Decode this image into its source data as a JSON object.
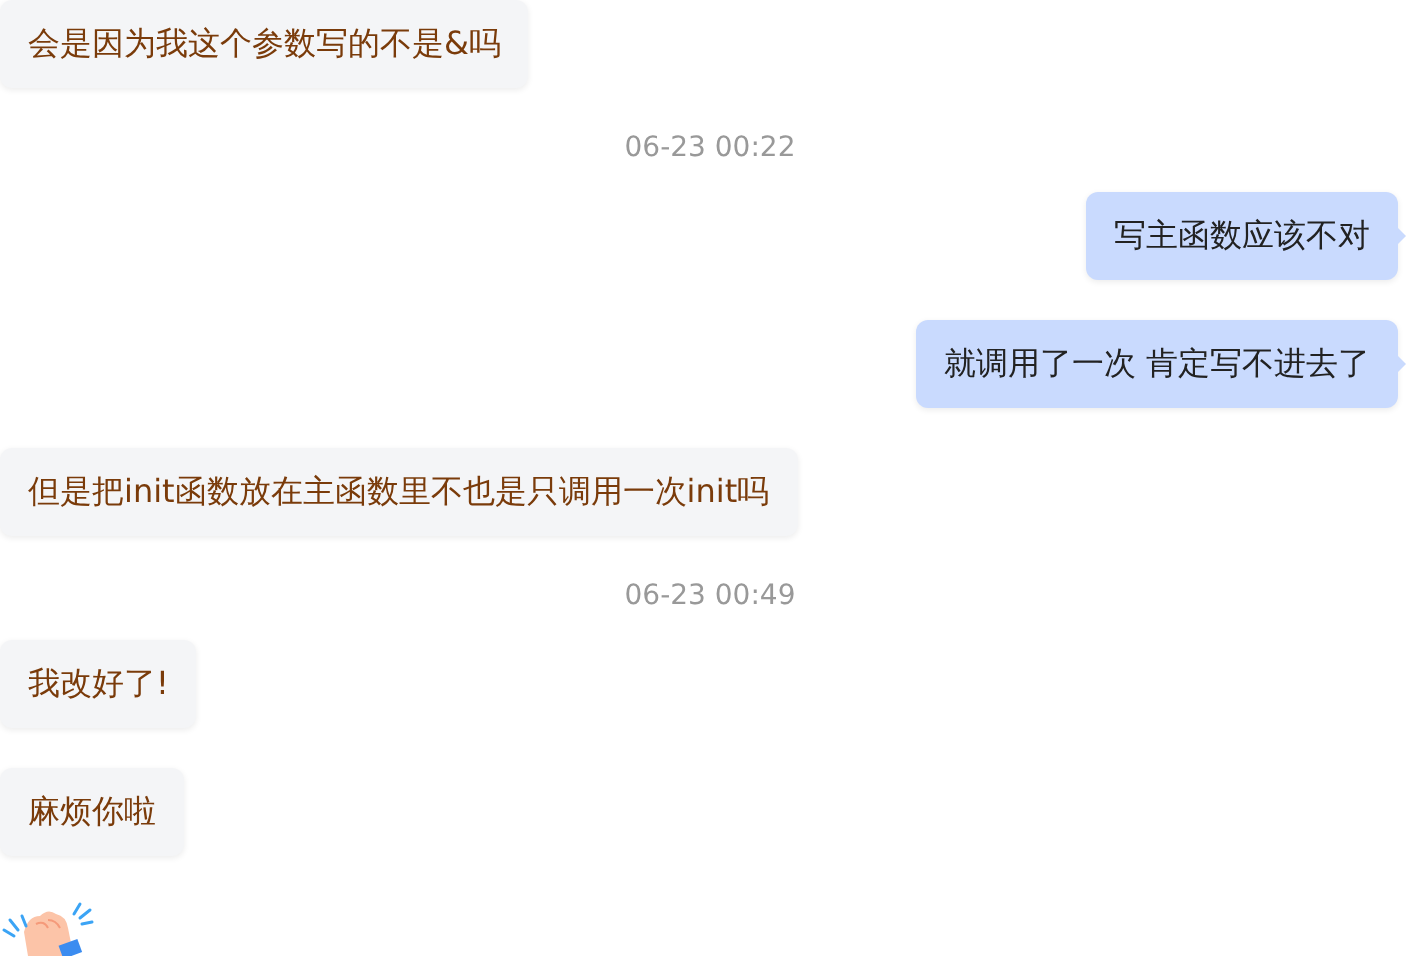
{
  "messages": [
    {
      "kind": "message",
      "mine": false,
      "text": "会是因为我这个参数写的不是&吗"
    },
    {
      "kind": "time",
      "text": "06-23 00:22"
    },
    {
      "kind": "message",
      "mine": true,
      "text": "写主函数应该不对"
    },
    {
      "kind": "message",
      "mine": true,
      "text": "就调用了一次 肯定写不进去了"
    },
    {
      "kind": "message",
      "mine": false,
      "text": "但是把init函数放在主函数里不也是只调用一次init吗"
    },
    {
      "kind": "time",
      "text": "06-23 00:49"
    },
    {
      "kind": "message",
      "mine": false,
      "text": "我改好了!"
    },
    {
      "kind": "message",
      "mine": false,
      "text": "麻烦你啦"
    },
    {
      "kind": "sticker",
      "mine": false
    }
  ]
}
